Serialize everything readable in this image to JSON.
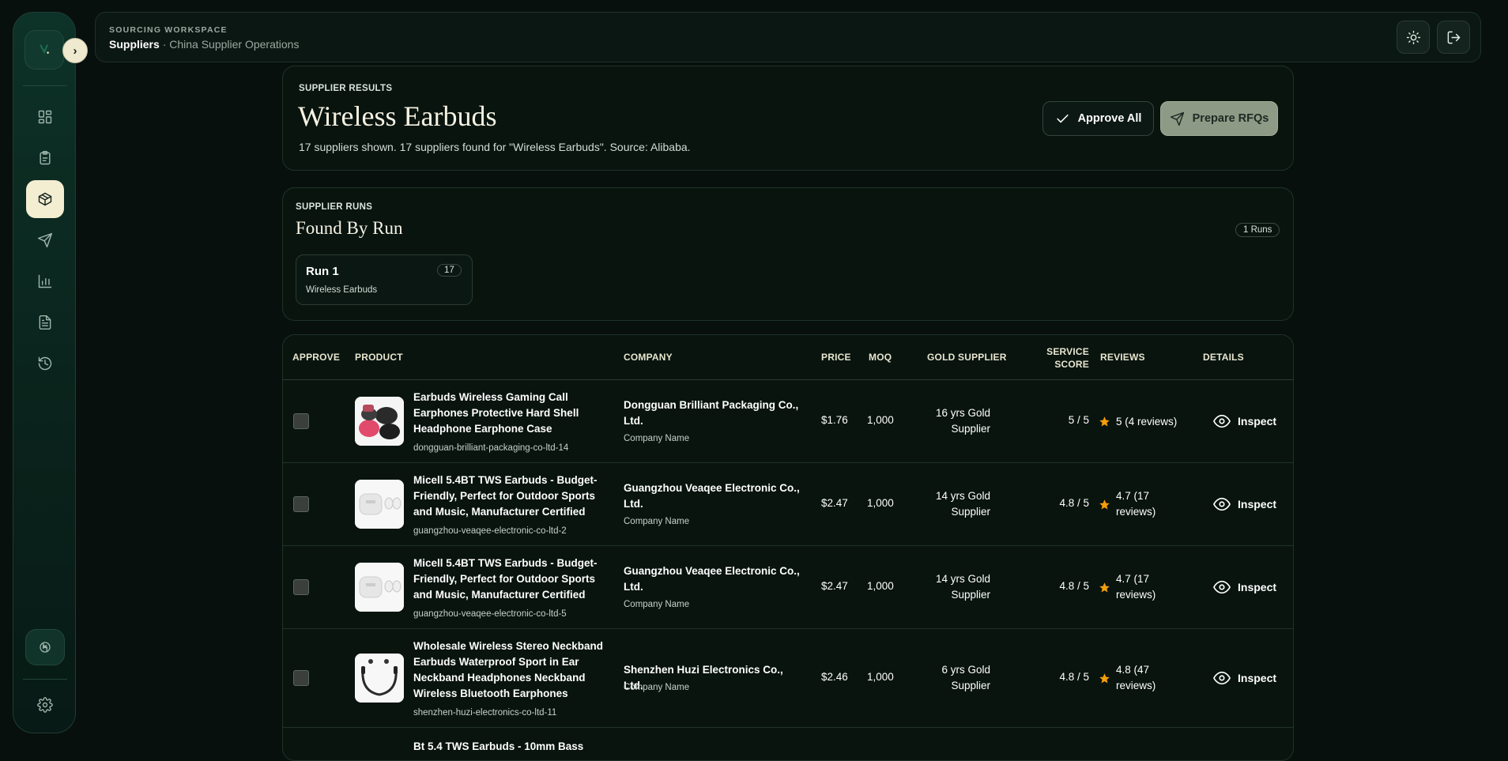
{
  "topbar": {
    "eyebrow": "SOURCING WORKSPACE",
    "section": "Suppliers",
    "subtitle": "· China Supplier Operations"
  },
  "icons": {
    "logo": "leaf-logo-icon",
    "expand": "chevron-right-icon",
    "theme": "sun-icon",
    "logout": "logout-icon",
    "assistant": "openai-icon",
    "settings": "gear-icon"
  },
  "sidebar": {
    "items": [
      {
        "name": "dashboard",
        "icon": "dashboard-icon"
      },
      {
        "name": "requests",
        "icon": "clipboard-icon"
      },
      {
        "name": "suppliers",
        "icon": "package-icon",
        "active": true
      },
      {
        "name": "rfqs",
        "icon": "send-icon"
      },
      {
        "name": "analytics",
        "icon": "bar-chart-icon"
      },
      {
        "name": "documents",
        "icon": "document-icon"
      },
      {
        "name": "history",
        "icon": "history-icon"
      }
    ]
  },
  "results": {
    "eyebrow": "SUPPLIER RESULTS",
    "title": "Wireless Earbuds",
    "summary": "17 suppliers shown. 17 suppliers found for \"Wireless Earbuds\". Source: Alibaba.",
    "approve_all": "Approve All",
    "prepare_rfqs": "Prepare RFQs"
  },
  "runs": {
    "eyebrow": "SUPPLIER RUNS",
    "title": "Found By Run",
    "count_badge": "1 Runs",
    "items": [
      {
        "label": "Run 1",
        "count": "17",
        "query": "Wireless Earbuds"
      }
    ]
  },
  "table": {
    "headers": {
      "approve": "APPROVE",
      "product": "PRODUCT",
      "company": "COMPANY",
      "price": "PRICE",
      "moq": "MOQ",
      "gold": "GOLD SUPPLIER",
      "service_1": "SERVICE",
      "service_2": "SCORE",
      "reviews": "REVIEWS",
      "details": "DETAILS"
    },
    "inspect_label": "Inspect",
    "company_label": "Company Name",
    "rows": [
      {
        "product": "Earbuds Wireless Gaming Call Earphones Protective Hard Shell Headphone Earphone Case",
        "slug": "dongguan-brilliant-packaging-co-ltd-14",
        "company": "Dongguan Brilliant Packaging Co., Ltd.",
        "price": "$1.76",
        "moq": "1,000",
        "gold": "16 yrs Gold Supplier",
        "score": "5 / 5",
        "reviews": "5 (4 reviews)"
      },
      {
        "product": "Micell 5.4BT TWS Earbuds - Budget-Friendly, Perfect for Outdoor Sports and Music, Manufacturer Certified",
        "slug": "guangzhou-veaqee-electronic-co-ltd-2",
        "company": "Guangzhou Veaqee Electronic Co., Ltd.",
        "price": "$2.47",
        "moq": "1,000",
        "gold": "14 yrs Gold Supplier",
        "score": "4.8 / 5",
        "reviews": "4.7 (17 reviews)"
      },
      {
        "product": "Micell 5.4BT TWS Earbuds - Budget-Friendly, Perfect for Outdoor Sports and Music, Manufacturer Certified",
        "slug": "guangzhou-veaqee-electronic-co-ltd-5",
        "company": "Guangzhou Veaqee Electronic Co., Ltd.",
        "price": "$2.47",
        "moq": "1,000",
        "gold": "14 yrs Gold Supplier",
        "score": "4.8 / 5",
        "reviews": "4.7 (17 reviews)"
      },
      {
        "product": "Wholesale Wireless Stereo Neckband Earbuds Waterproof Sport in Ear Neckband Headphones Neckband Wireless Bluetooth Earphones",
        "slug": "shenzhen-huzi-electronics-co-ltd-11",
        "company": "Shenzhen Huzi Electronics Co., Ltd.",
        "price": "$2.46",
        "moq": "1,000",
        "gold": "6 yrs Gold Supplier",
        "score": "4.8 / 5",
        "reviews": "4.8 (47 reviews)"
      },
      {
        "product": "Bt 5.4 TWS Earbuds - 10mm Bass"
      }
    ]
  },
  "colors": {
    "background": "#07100d",
    "sidebar": "#0d3227",
    "accent_cream": "#f3edd2",
    "primary_button": "#8d9a86",
    "star": "#f59e0b"
  }
}
